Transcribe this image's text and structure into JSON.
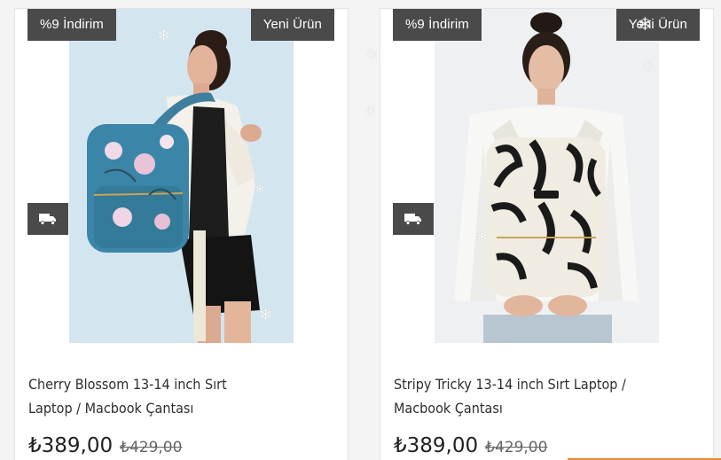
{
  "products": [
    {
      "discount_badge": "%9 İndirim",
      "new_badge": "Yeni Ürün",
      "title": "Cherry Blossom 13-14 inch Sırt Laptop / Macbook Çantası",
      "price": "₺389,00",
      "old_price": "₺429,00",
      "shipping_icon": "truck-icon",
      "image": "model-with-floral-backpack"
    },
    {
      "discount_badge": "%9 İndirim",
      "new_badge": "Yeni Ürün",
      "title": "Stripy Tricky 13-14 inch Sırt Laptop / Macbook Çantası",
      "price": "₺389,00",
      "old_price": "₺429,00",
      "shipping_icon": "truck-icon",
      "image": "model-with-zebra-backpack"
    }
  ],
  "colors": {
    "badge_bg": "#4a4a4a",
    "badge_text": "#ffffff",
    "accent": "#e8893a"
  }
}
